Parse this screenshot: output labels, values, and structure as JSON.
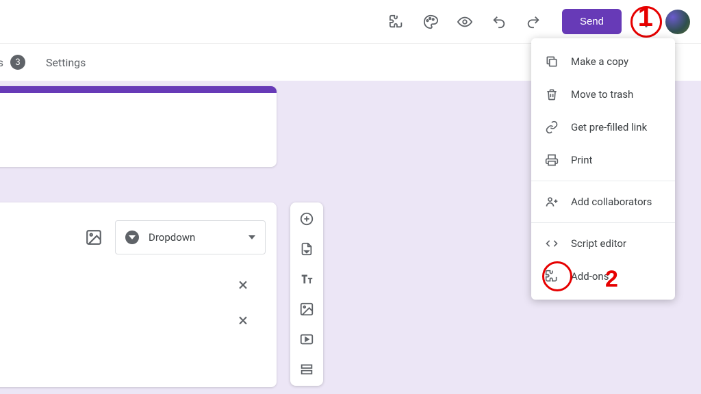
{
  "toolbar": {
    "send_label": "Send"
  },
  "tabs": {
    "responses_fragment": "ses",
    "responses_count": "3",
    "settings_label": "Settings"
  },
  "question": {
    "type_label": "Dropdown"
  },
  "menu": {
    "make_copy": "Make a copy",
    "move_trash": "Move to trash",
    "prefilled": "Get pre-filled link",
    "print": "Print",
    "collab": "Add collaborators",
    "script": "Script editor",
    "addons": "Add-ons"
  },
  "annotations": {
    "one": "1",
    "two": "2"
  }
}
